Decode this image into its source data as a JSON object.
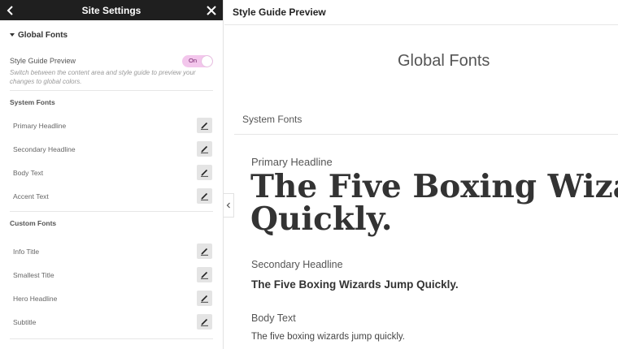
{
  "panel": {
    "title": "Site Settings",
    "section_title": "Global Fonts",
    "style_guide": {
      "label": "Style Guide Preview",
      "toggle_text": "On",
      "hint": "Switch between the content area and style guide to preview your changes to global colors."
    },
    "system_fonts": {
      "heading": "System Fonts",
      "items": [
        {
          "label": "Primary Headline"
        },
        {
          "label": "Secondary Headline"
        },
        {
          "label": "Body Text"
        },
        {
          "label": "Accent Text"
        }
      ]
    },
    "custom_fonts": {
      "heading": "Custom Fonts",
      "items": [
        {
          "label": "Info Title"
        },
        {
          "label": "Smallest Title"
        },
        {
          "label": "Hero Headline"
        },
        {
          "label": "Subtitle"
        }
      ]
    }
  },
  "preview": {
    "header": "Style Guide Preview",
    "title": "Global Fonts",
    "system_label": "System Fonts",
    "primary": {
      "label": "Primary Headline",
      "sample": "The Five Boxing Wizards Jump Quickly."
    },
    "secondary": {
      "label": "Secondary Headline",
      "sample": "The Five Boxing Wizards Jump Quickly."
    },
    "body": {
      "label": "Body Text",
      "sample": "The five boxing wizards jump quickly."
    }
  },
  "colors": {
    "header_bg": "#1f1f1f",
    "toggle_bg": "#f3c6ec",
    "edit_btn_bg": "#e4e4e4"
  },
  "icons": {
    "back": "chevron-left-icon",
    "close": "close-icon",
    "edit": "pencil-icon",
    "collapse": "chevron-left-icon",
    "section": "caret-down-icon"
  }
}
